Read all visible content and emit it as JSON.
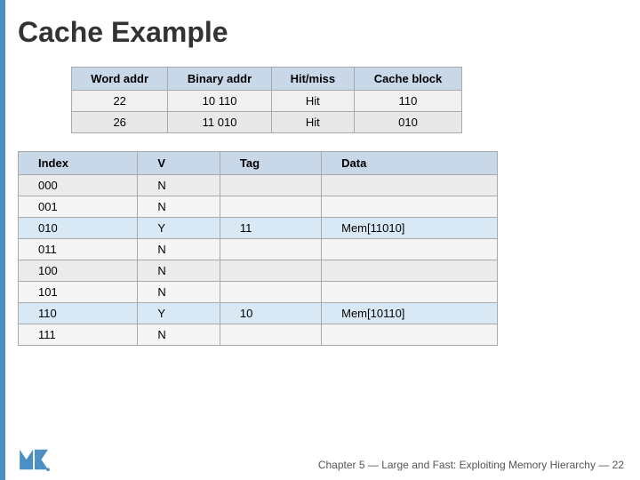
{
  "title": "Cache Example",
  "topTable": {
    "headers": [
      "Word addr",
      "Binary addr",
      "Hit/miss",
      "Cache block"
    ],
    "rows": [
      [
        "22",
        "10 110",
        "Hit",
        "110"
      ],
      [
        "26",
        "11 010",
        "Hit",
        "010"
      ]
    ]
  },
  "bottomTable": {
    "headers": [
      "Index",
      "V",
      "Tag",
      "Data"
    ],
    "rows": [
      [
        "000",
        "N",
        "",
        ""
      ],
      [
        "001",
        "N",
        "",
        ""
      ],
      [
        "010",
        "Y",
        "11",
        "Mem[11010]"
      ],
      [
        "011",
        "N",
        "",
        ""
      ],
      [
        "100",
        "N",
        "",
        ""
      ],
      [
        "101",
        "N",
        "",
        ""
      ],
      [
        "110",
        "Y",
        "10",
        "Mem[10110]"
      ],
      [
        "111",
        "N",
        "",
        ""
      ]
    ]
  },
  "footer": "Chapter 5 — Large and Fast: Exploiting Memory Hierarchy — 22",
  "highlightRows": [
    2,
    6
  ]
}
